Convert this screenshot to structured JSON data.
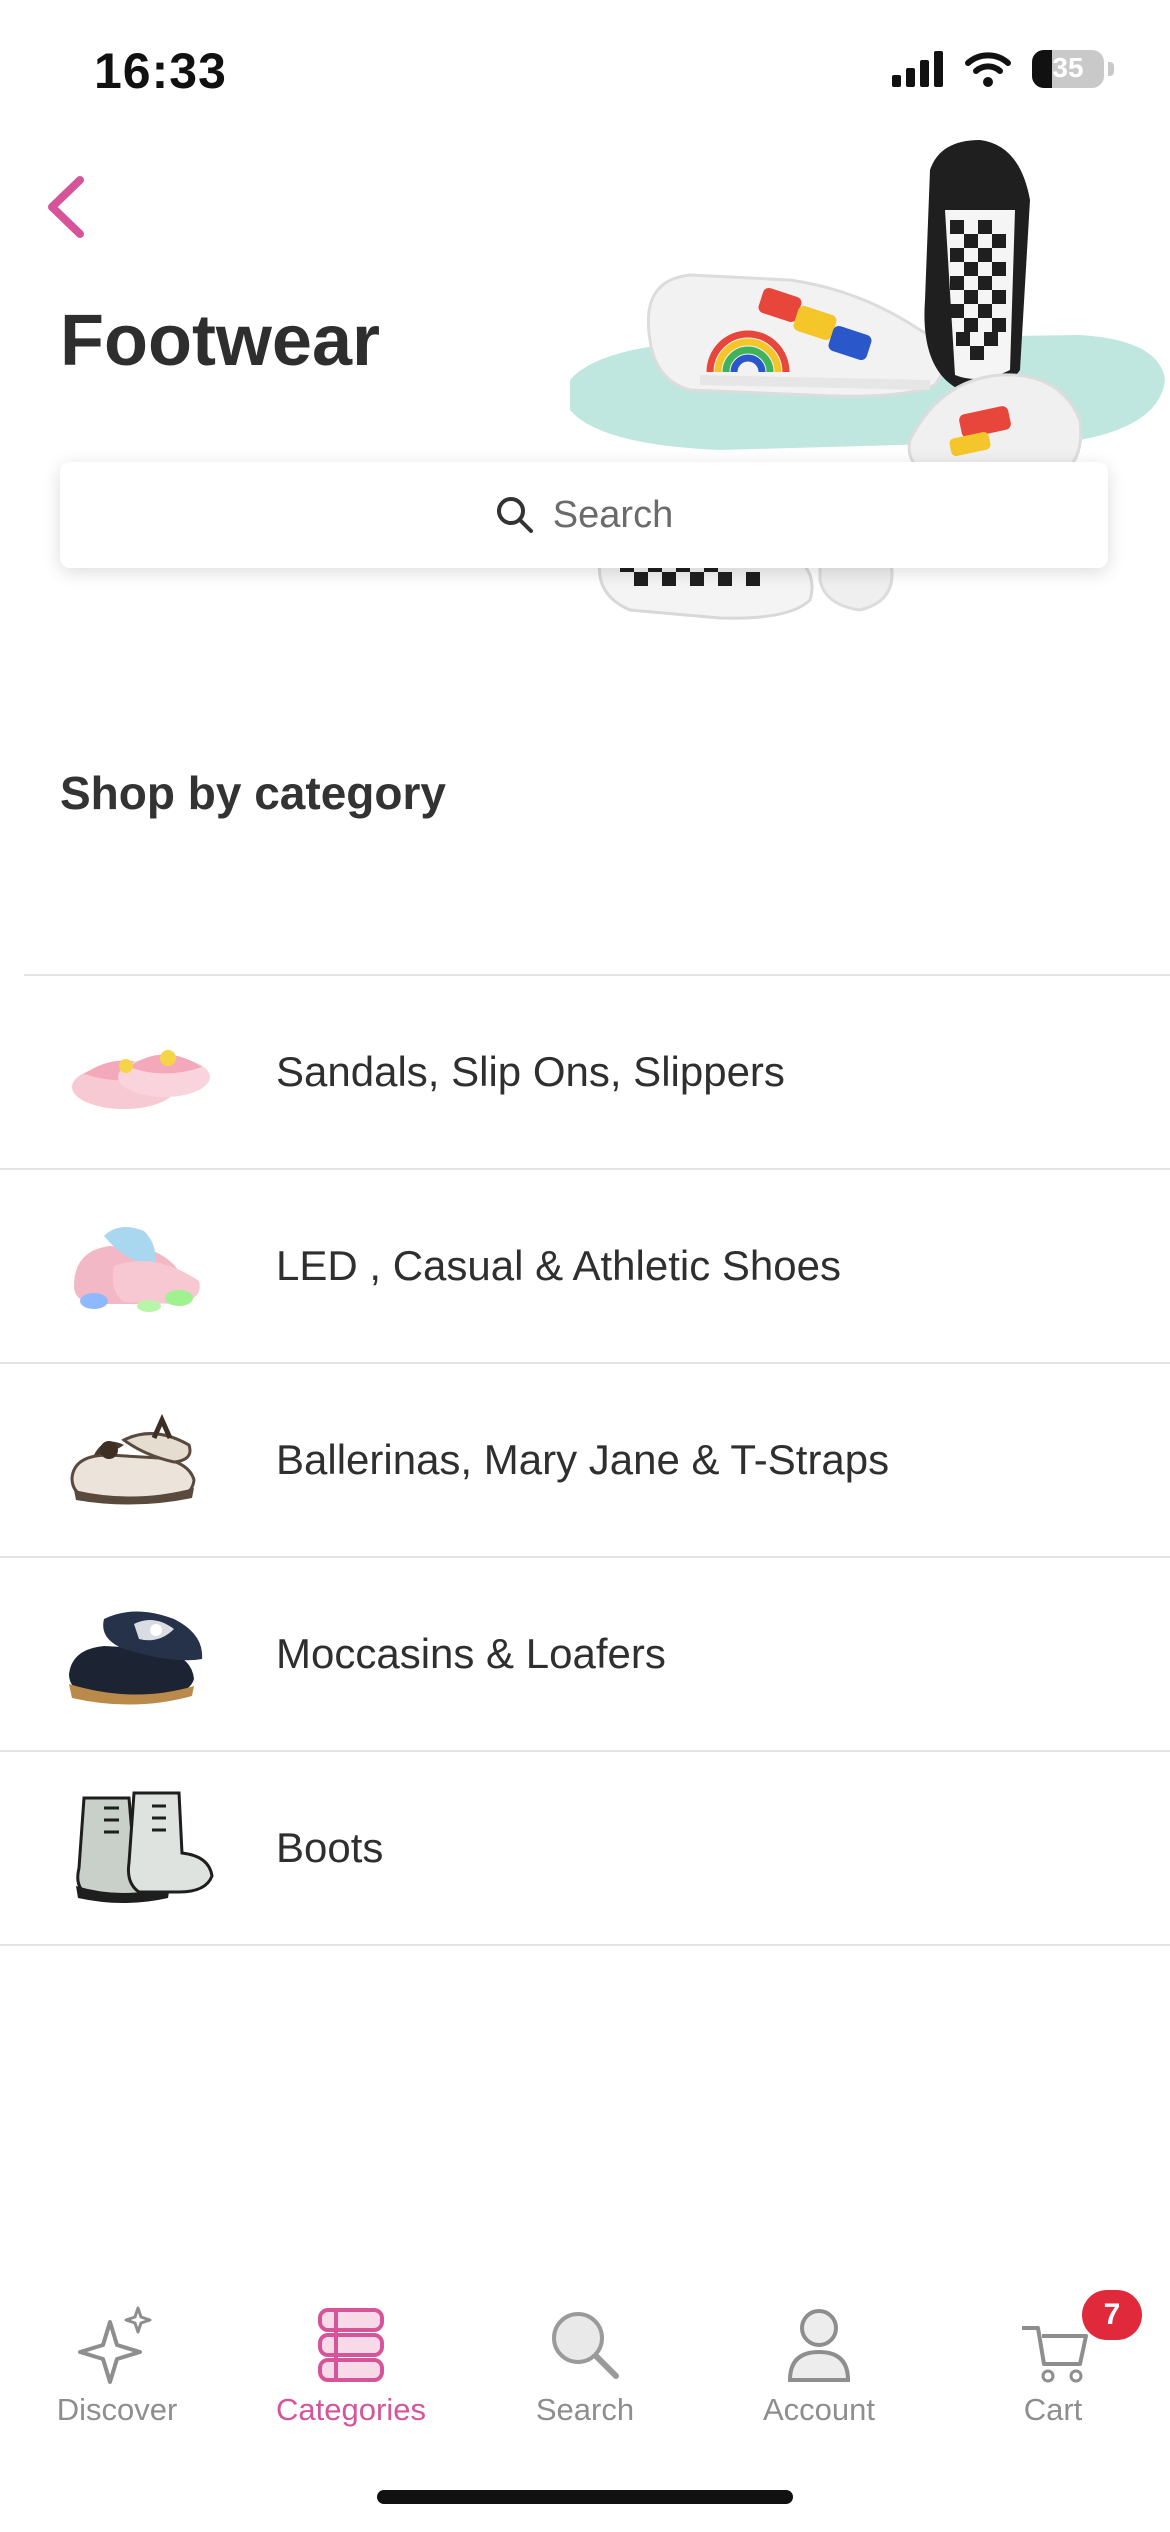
{
  "status_bar": {
    "time": "16:33",
    "battery": "35"
  },
  "header": {
    "title": "Footwear",
    "back_icon": "chevron-left-icon"
  },
  "search": {
    "placeholder": "Search",
    "icon": "search-icon"
  },
  "section": {
    "title": "Shop by category"
  },
  "categories": [
    {
      "label": "Sandals, Slip Ons, Slippers",
      "thumb": "pink-slides"
    },
    {
      "label": "LED , Casual & Athletic Shoes",
      "thumb": "led-sneakers"
    },
    {
      "label": "Ballerinas, Mary Jane & T-Straps",
      "thumb": "mary-jane-shoes"
    },
    {
      "label": "Moccasins & Loafers",
      "thumb": "loafers"
    },
    {
      "label": "Boots",
      "thumb": "boots"
    }
  ],
  "tabbar": {
    "items": [
      {
        "label": "Discover",
        "icon": "sparkle-icon"
      },
      {
        "label": "Categories",
        "icon": "categories-icon",
        "active": true
      },
      {
        "label": "Search",
        "icon": "search-icon"
      },
      {
        "label": "Account",
        "icon": "person-icon"
      },
      {
        "label": "Cart",
        "icon": "cart-icon",
        "badge": "7"
      }
    ]
  },
  "colors": {
    "accent": "#d6559a",
    "badge": "#e02a3c",
    "divider": "#e4e4e4",
    "text": "#2f2f2f"
  }
}
